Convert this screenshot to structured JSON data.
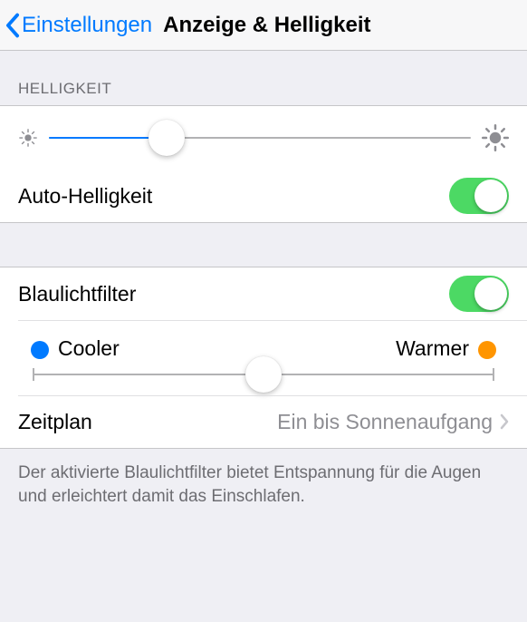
{
  "nav": {
    "back_label": "Einstellungen",
    "title": "Anzeige & Helligkeit"
  },
  "section_headers": {
    "brightness": "HELLIGKEIT"
  },
  "brightness": {
    "slider_percent": 28,
    "auto_label": "Auto-Helligkeit",
    "auto_on": true
  },
  "nightshift": {
    "label": "Blaulichtfilter",
    "on": true,
    "cooler_label": "Cooler",
    "warmer_label": "Warmer",
    "slider_percent": 50,
    "schedule_label": "Zeitplan",
    "schedule_value": "Ein bis Sonnenaufgang"
  },
  "footer": "Der aktivierte Blaulichtfilter bietet Entspannung für die Augen und erleichtert damit das Einschlafen.",
  "colors": {
    "tint": "#007aff",
    "green": "#4cd964",
    "orange": "#ff9500",
    "gray_icon": "#8e8e93"
  }
}
